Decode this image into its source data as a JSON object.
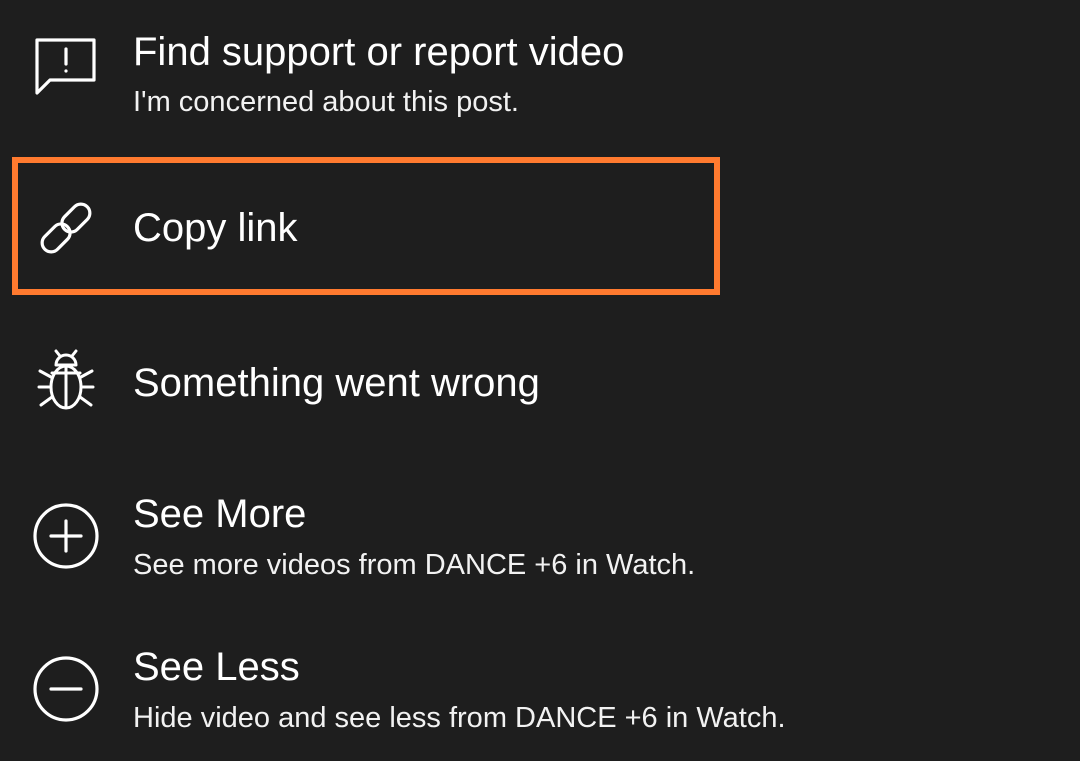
{
  "menu": {
    "items": [
      {
        "icon": "report-flag-icon",
        "title": "Find support or report video",
        "subtitle": "I'm concerned about this post."
      },
      {
        "icon": "link-icon",
        "title": "Copy link",
        "subtitle": ""
      },
      {
        "icon": "bug-icon",
        "title": "Something went wrong",
        "subtitle": ""
      },
      {
        "icon": "plus-circle-icon",
        "title": "See More",
        "subtitle": "See more videos from DANCE +6 in Watch."
      },
      {
        "icon": "minus-circle-icon",
        "title": "See Less",
        "subtitle": "Hide video and see less from DANCE +6 in Watch."
      }
    ]
  },
  "colors": {
    "background": "#1e1e1e",
    "text": "#ffffff",
    "highlight": "#ff7a2f"
  }
}
